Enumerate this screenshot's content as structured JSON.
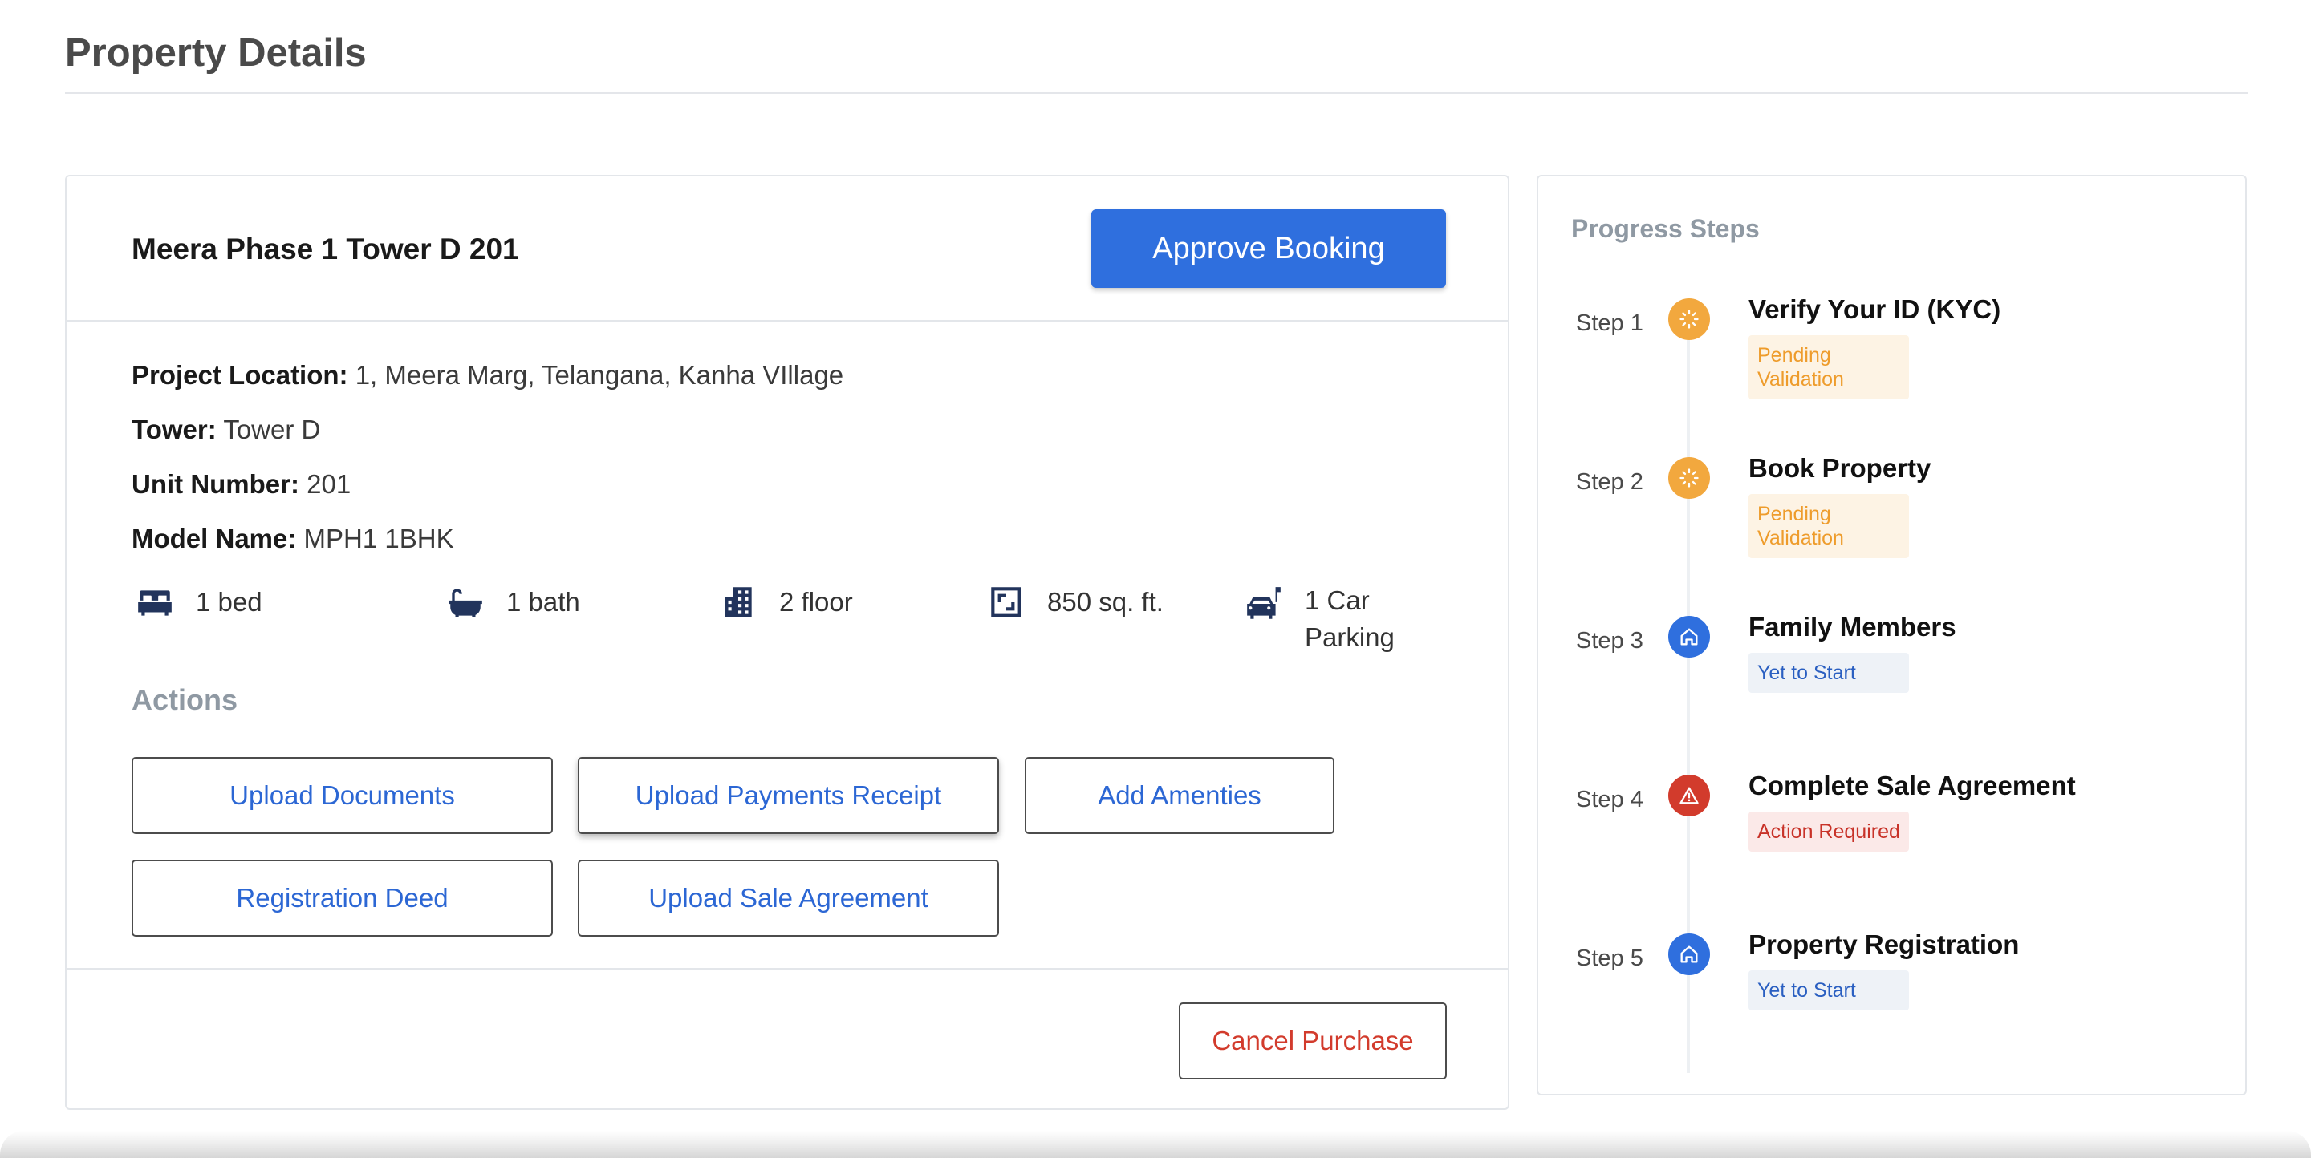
{
  "page": {
    "title": "Property Details"
  },
  "property": {
    "name": "Meera Phase 1 Tower D 201",
    "approve_label": "Approve Booking",
    "details": [
      {
        "label": "Project Location:",
        "value": "1, Meera Marg, Telangana, Kanha VIllage"
      },
      {
        "label": "Tower:",
        "value": "Tower D"
      },
      {
        "label": "Unit Number:",
        "value": "201"
      },
      {
        "label": "Model Name:",
        "value": "MPH1 1BHK"
      }
    ],
    "features": [
      {
        "icon": "bed-icon",
        "text": "1 bed"
      },
      {
        "icon": "bathtub-icon",
        "text": "1 bath"
      },
      {
        "icon": "building-icon",
        "text": "2 floor"
      },
      {
        "icon": "area-icon",
        "text": "850 sq. ft."
      },
      {
        "icon": "car-parking-icon",
        "text": "1 Car Parking"
      }
    ],
    "actions_heading": "Actions",
    "actions": [
      "Upload Documents",
      "Upload Payments Receipt",
      "Add Amenties",
      "Registration Deed",
      "Upload Sale Agreement"
    ],
    "cancel_label": "Cancel Purchase"
  },
  "progress": {
    "heading": "Progress Steps",
    "steps": [
      {
        "label": "Step 1",
        "title": "Verify Your ID (KYC)",
        "status": "Pending Validation",
        "state": "pending",
        "icon": "spinner-icon",
        "color": "#f2a83e"
      },
      {
        "label": "Step 2",
        "title": "Book Property",
        "status": "Pending Validation",
        "state": "pending",
        "icon": "spinner-icon",
        "color": "#f2a83e"
      },
      {
        "label": "Step 3",
        "title": "Family Members",
        "status": "Yet to Start",
        "state": "start",
        "icon": "home-icon",
        "color": "#2f6fde"
      },
      {
        "label": "Step 4",
        "title": "Complete Sale Agreement",
        "status": "Action Required",
        "state": "action",
        "icon": "warning-icon",
        "color": "#d23b2c"
      },
      {
        "label": "Step 5",
        "title": "Property Registration",
        "status": "Yet to Start",
        "state": "start",
        "icon": "home-icon",
        "color": "#2f6fde"
      }
    ]
  },
  "colors": {
    "primary": "#2f6fde",
    "link": "#2c67d4",
    "danger": "#d23b2c",
    "pending": "#f2a83e",
    "muted_heading": "#8f99a3",
    "icon_navy": "#22345c"
  }
}
